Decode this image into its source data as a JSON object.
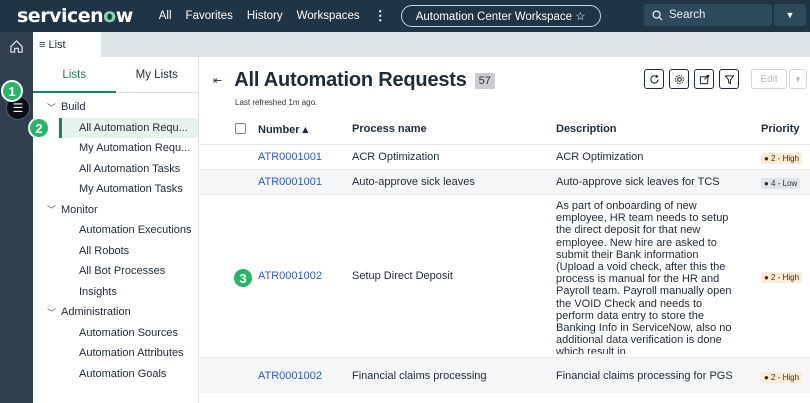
{
  "topnav": {
    "logo": "servicenow",
    "links": [
      "All",
      "Favorites",
      "History",
      "Workspaces"
    ],
    "more": "⋮",
    "workspace": "Automation Center Workspace ☆",
    "search_placeholder": "Search"
  },
  "tabstrip": {
    "tab_label": "≡ List"
  },
  "badges": [
    "1",
    "2",
    "3"
  ],
  "sidebar": {
    "tabs": [
      "Lists",
      "My Lists"
    ],
    "groups": [
      {
        "label": "Build",
        "items": [
          "All Automation Requ...",
          "My Automation Requ...",
          "All Automation Tasks",
          "My Automation Tasks"
        ]
      },
      {
        "label": "Monitor",
        "items": [
          "Automation Executions",
          "All Robots",
          "All Bot Processes",
          "Insights"
        ]
      },
      {
        "label": "Administration",
        "items": [
          "Automation Sources",
          "Automation Attributes",
          "Automation Goals"
        ]
      }
    ]
  },
  "main": {
    "title": "All Automation Requests",
    "count": "57",
    "refreshed": "Last refreshed 1m ago.",
    "edit_label": "Edit",
    "columns": [
      "Number ▴",
      "Process name",
      "Description",
      "Priority"
    ],
    "rows": [
      {
        "number": "ATR0001001",
        "process": "ACR Optimization",
        "description": "ACR Optimization",
        "priority": "● 2 - High"
      },
      {
        "number": "ATR0001001",
        "process": "Auto-approve sick leaves",
        "description": "Auto-approve sick leaves for TCS",
        "priority": "● 4 - Low"
      },
      {
        "number": "ATR0001002",
        "process": "Setup Direct Deposit",
        "description": "As part of onboarding of new employee, HR team needs to setup the direct deposit for that new employee. New hire are asked to submit their Bank information (Upload a void check, after this the process is manual for the HR and Payroll team. Payroll manually open the VOID Check and needs to perform data entry to store the Banking Info in ServiceNow, also no additional data verification is done which result in",
        "priority": "● 2 - High"
      },
      {
        "number": "ATR0001002",
        "process": "Financial claims processing",
        "description": "Financial claims processing for PGS",
        "priority": "● 2 - High"
      }
    ]
  },
  "colors": {
    "nav": "#1f3444",
    "rail": "#2f3f4d",
    "accent": "#17855a",
    "badge": "#27b567",
    "link": "#2c5ad6"
  }
}
